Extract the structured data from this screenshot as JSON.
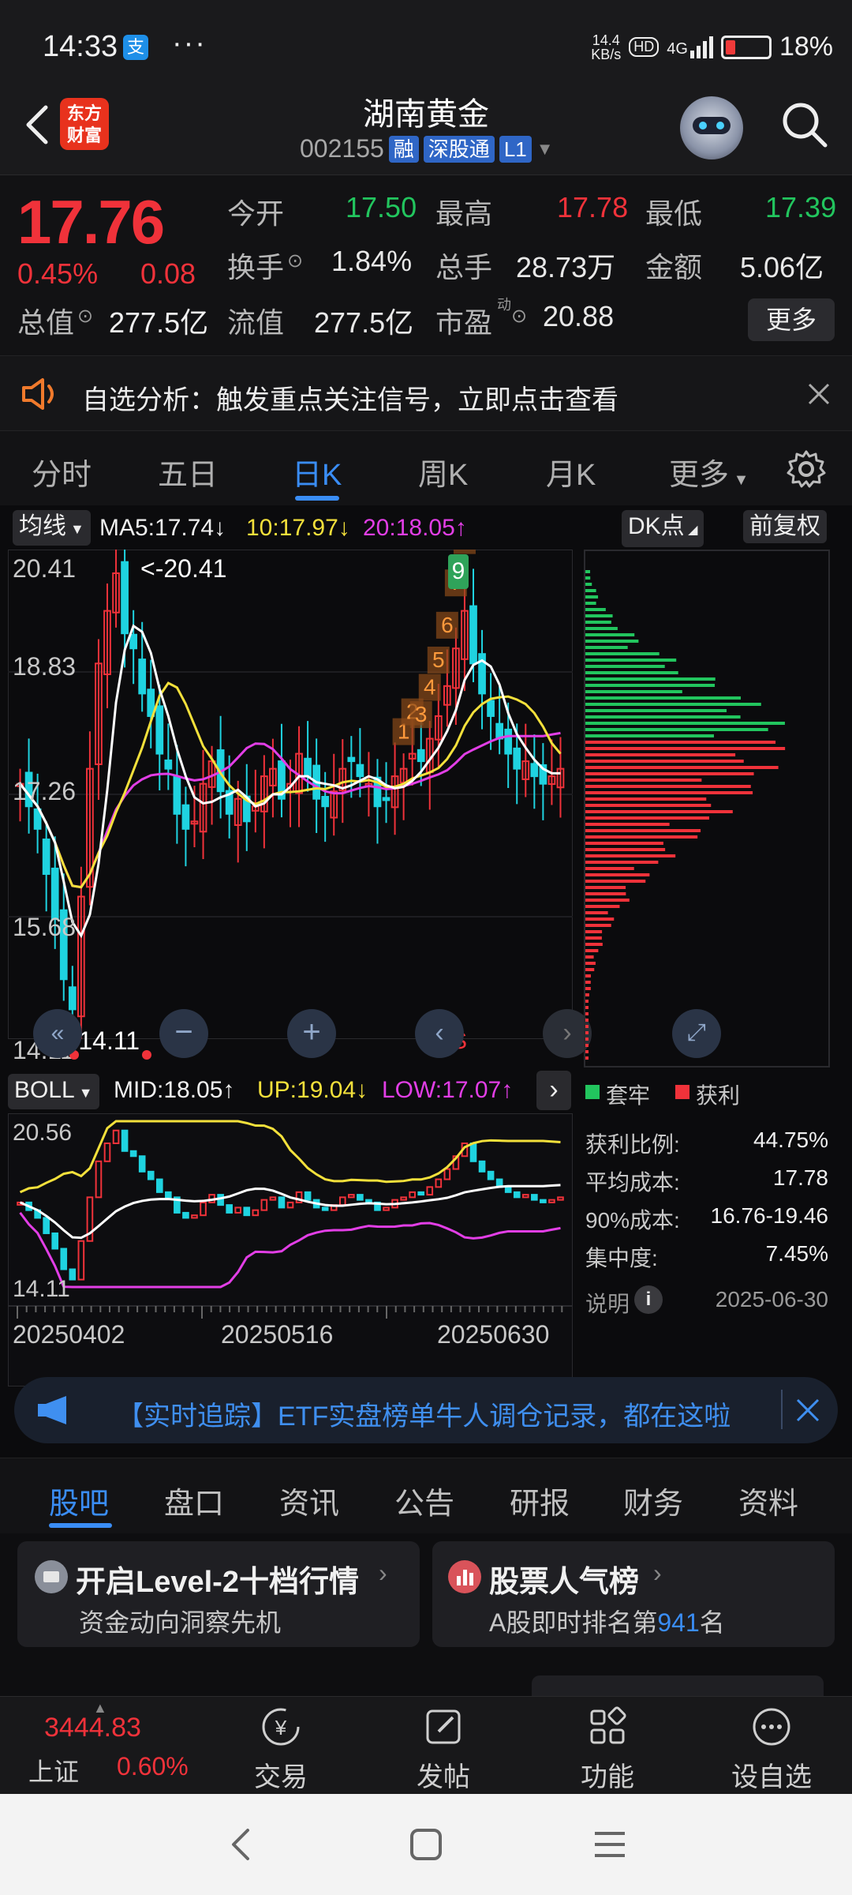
{
  "status_bar": {
    "time": "14:33",
    "net_speed_top": "14.4",
    "net_speed_bottom": "KB/s",
    "hd": "HD",
    "signal": "4G",
    "battery": "18%"
  },
  "header": {
    "logo_line1": "东方",
    "logo_line2": "财富",
    "name": "湖南黄金",
    "code": "002155",
    "tag_margin": "融",
    "tag_connect": "深股通",
    "tag_level": "L1"
  },
  "quote": {
    "price": "17.76",
    "pct": "0.45%",
    "change": "0.08",
    "open_label": "今开",
    "open": "17.50",
    "high_label": "最高",
    "high": "17.78",
    "low_label": "最低",
    "low": "17.39",
    "turnover_label": "换手",
    "turnover": "1.84%",
    "volume_label": "总手",
    "volume": "28.73万",
    "amount_label": "金额",
    "amount": "5.06亿",
    "mktcap_label": "总值",
    "mktcap": "277.5亿",
    "float_label": "流值",
    "float": "277.5亿",
    "pe_label": "市盈",
    "pe_sup": "动",
    "pe": "20.88",
    "more": "更多"
  },
  "notice": {
    "text": "自选分析：触发重点关注信号，立即点击查看"
  },
  "kline_tabs": [
    "分时",
    "五日",
    "日K",
    "周K",
    "月K",
    "更多"
  ],
  "chart": {
    "ma_selector": "均线",
    "ma5": "MA5:17.74",
    "ma10": "10:17.97",
    "ma20": "20:18.05",
    "dk": "DK点",
    "adjust": "前复权",
    "y_labels": [
      "20.41",
      "18.83",
      "17.26",
      "15.68",
      "14.11"
    ],
    "max_label": "<-20.41",
    "min_label": "<-14.11",
    "signal_9": "9",
    "seq_labels": [
      "1",
      "2",
      "3",
      "4",
      "5",
      "6",
      "7",
      "8"
    ],
    "s_marker": "S",
    "boll_selector": "BOLL",
    "boll_mid": "MID:18.05",
    "boll_up": "UP:19.04",
    "boll_low": "LOW:17.07",
    "boll_y_top": "20.56",
    "boll_y_bottom": "14.11",
    "dates": [
      "20250402",
      "20250516",
      "20250630"
    ],
    "legend_trapped": "套牢",
    "legend_profit": "获利",
    "stats": [
      {
        "label": "获利比例:",
        "value": "44.75%"
      },
      {
        "label": "平均成本:",
        "value": "17.78"
      },
      {
        "label": "90%成本:",
        "value": "16.76-19.46"
      },
      {
        "label": "集中度:",
        "value": "7.45%"
      }
    ],
    "note_label": "说明",
    "note_date": "2025-06-30"
  },
  "banner": {
    "text": "【实时追踪】ETF实盘榜单牛人调仓记录，都在这啦"
  },
  "section_tabs": [
    "股吧",
    "盘口",
    "资讯",
    "公告",
    "研报",
    "财务",
    "资料"
  ],
  "cards": {
    "left_title": "开启Level-2十档行情",
    "left_sub": "资金动向洞察先机",
    "right_title": "股票人气榜",
    "right_sub_pre": "A股即时排名第",
    "right_rank": "941",
    "right_sub_post": "名"
  },
  "bottom_nav": {
    "index_value": "3444.83",
    "index_name": "上证",
    "index_pct": "0.60%",
    "items": [
      "交易",
      "发帖",
      "功能",
      "设自选"
    ]
  },
  "colors": {
    "up": "#f0323a",
    "down": "#1fd3e0",
    "accent": "#3a8df5"
  }
}
